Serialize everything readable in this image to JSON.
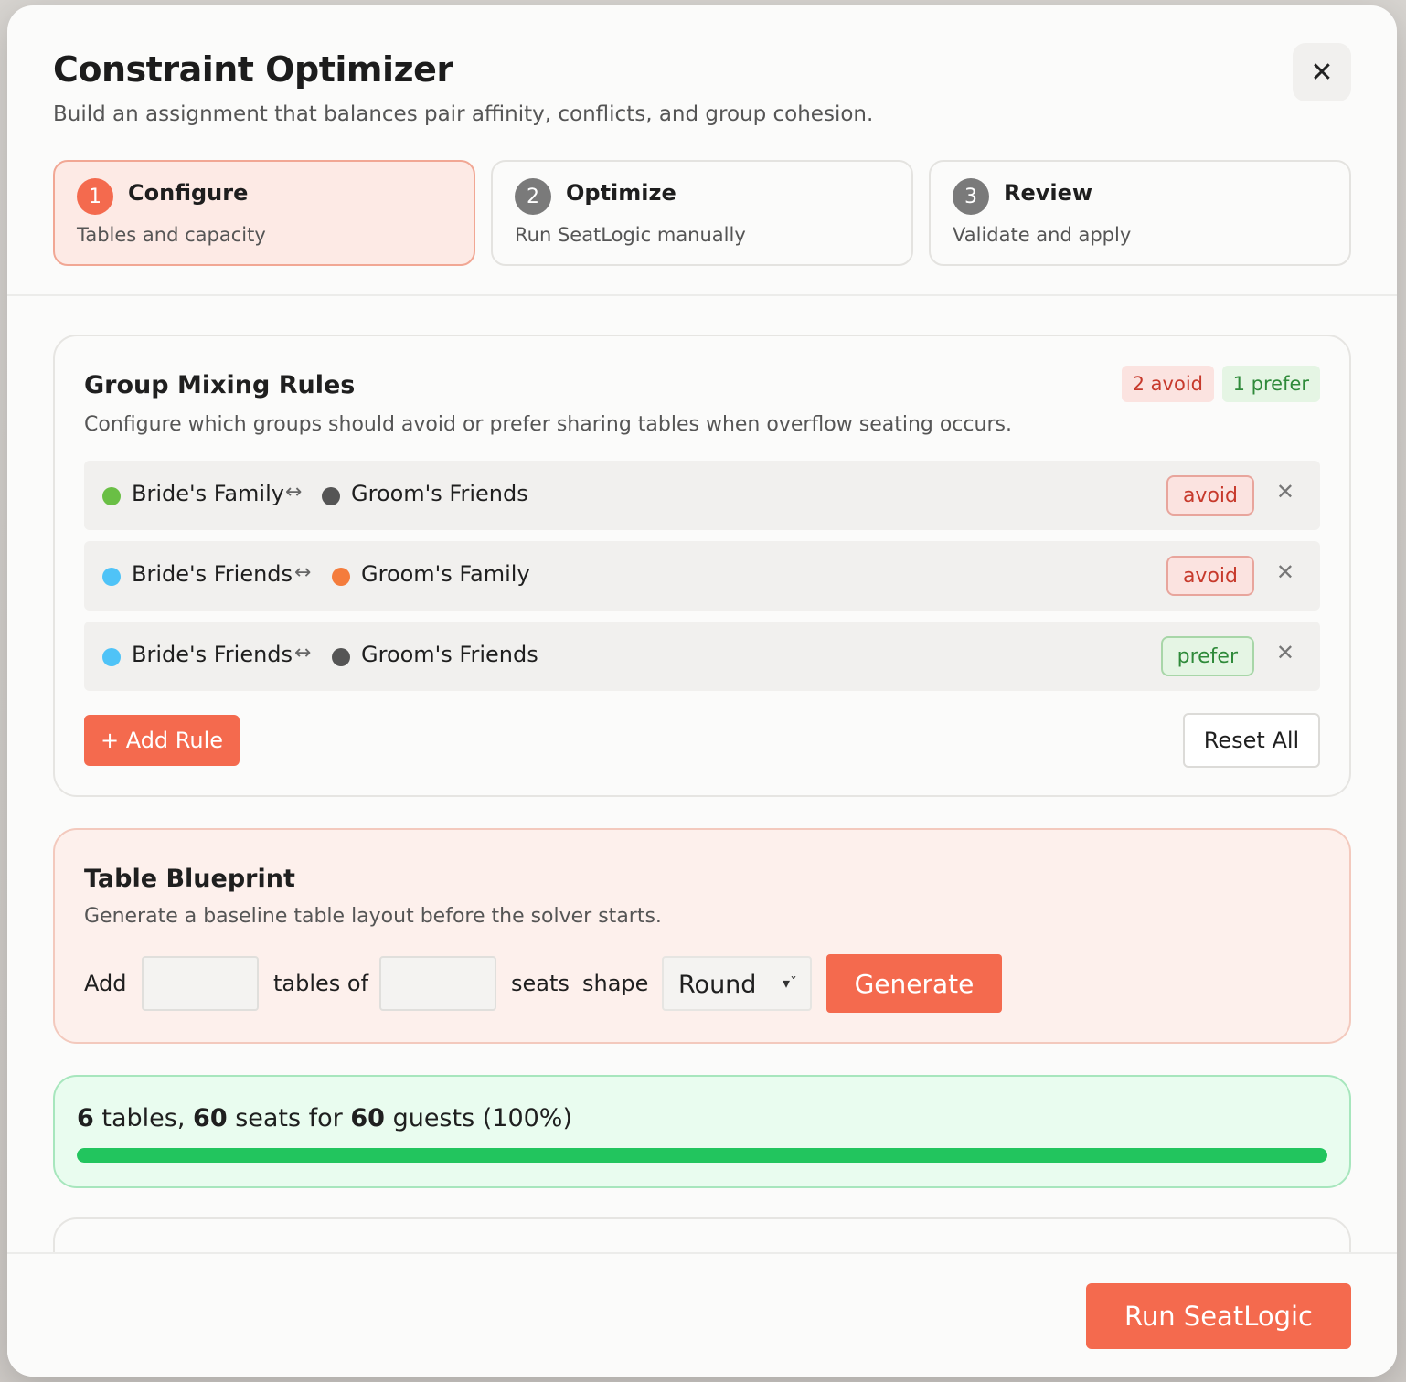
{
  "modal": {
    "title": "Constraint Optimizer",
    "subtitle": "Build an assignment that balances pair affinity, conflicts, and group cohesion.",
    "close_icon": "close-icon"
  },
  "steps": [
    {
      "number": "1",
      "title": "Configure",
      "description": "Tables and capacity",
      "active": true
    },
    {
      "number": "2",
      "title": "Optimize",
      "description": "Run SeatLogic manually",
      "active": false
    },
    {
      "number": "3",
      "title": "Review",
      "description": "Validate and apply",
      "active": false
    }
  ],
  "rules": {
    "title": "Group Mixing Rules",
    "description": "Configure which groups should avoid or prefer sharing tables when overflow seating occurs.",
    "avoid_count_label": "2 avoid",
    "prefer_count_label": "1 prefer",
    "items": [
      {
        "group_a": "Bride's Family",
        "color_a": "#6abf45",
        "arrow": "↔",
        "group_b": "Groom's Friends",
        "color_b": "#555555",
        "type": "avoid"
      },
      {
        "group_a": "Bride's Friends",
        "color_a": "#4fc3f7",
        "arrow": "↔",
        "group_b": "Groom's Family",
        "color_b": "#f47c3c",
        "type": "avoid"
      },
      {
        "group_a": "Bride's Friends",
        "color_a": "#4fc3f7",
        "arrow": "↔",
        "group_b": "Groom's Friends",
        "color_b": "#555555",
        "type": "prefer"
      }
    ],
    "add_rule_label": "+ Add Rule",
    "reset_label": "Reset All"
  },
  "blueprint": {
    "title": "Table Blueprint",
    "description": "Generate a baseline table layout before the solver starts.",
    "add_label": "Add",
    "tables_of_label": "tables of",
    "seats_label": "seats",
    "shape_label": "shape",
    "table_count_value": "",
    "seat_count_value": "",
    "shape_value": "Round",
    "generate_label": "Generate"
  },
  "summary": {
    "tables": "6",
    "tables_word": "tables,",
    "seats": "60",
    "seats_word": "seats for",
    "guests": "60",
    "guests_word": "guests (100%)",
    "progress_percent": 100
  },
  "footer": {
    "run_label": "Run SeatLogic"
  },
  "colors": {
    "accent": "#f46a4e",
    "success": "#22c55e",
    "avoid": "#c73a2c",
    "prefer": "#2f8a3a"
  }
}
